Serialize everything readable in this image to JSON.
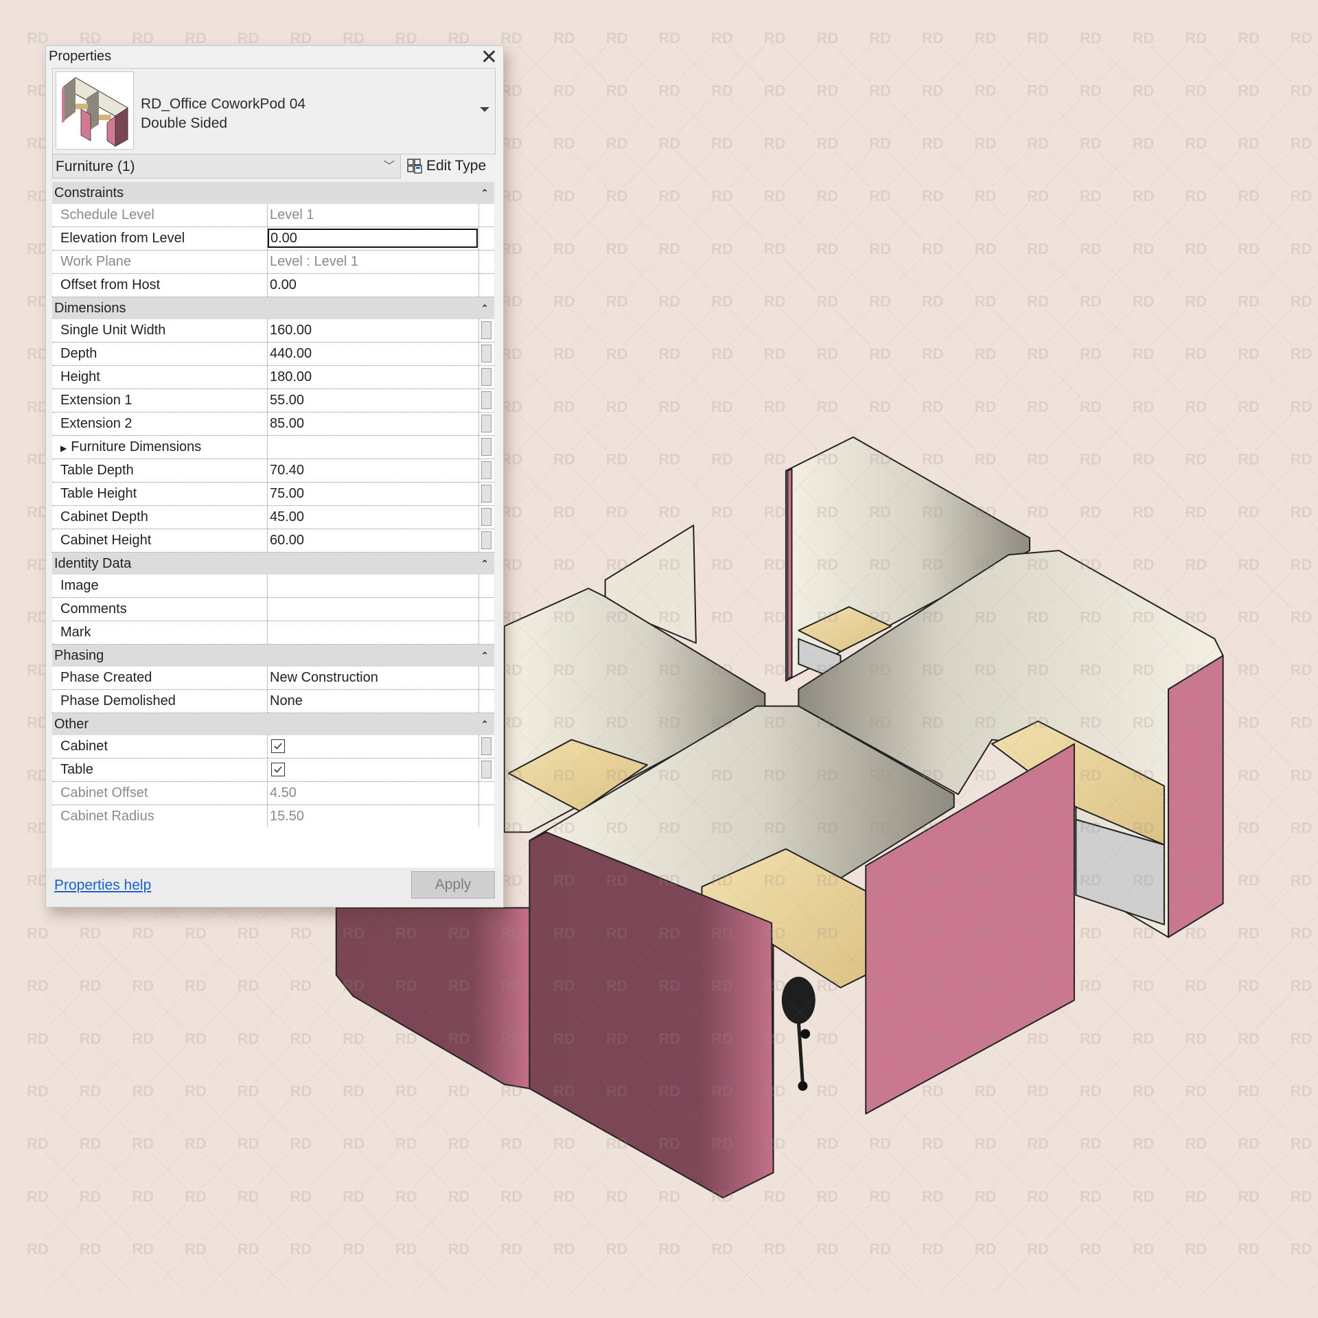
{
  "watermark": {
    "text": "RD"
  },
  "colors": {
    "background": "#efe2db",
    "pod_pink": "#c97890",
    "pod_pink_shadow": "#7c4656",
    "pod_inner": "#ebe7d9",
    "pod_inner_shadow": "#9a968a",
    "table_wood": "#ecd7a0",
    "cabinet_grey": "#cfcfcf",
    "link_blue": "#1a62c9"
  },
  "properties_panel": {
    "title": "Properties",
    "close_icon": "close-icon",
    "type_selector": {
      "family": "RD_Office CoworkPod 04",
      "type": "Double Sided"
    },
    "instance_filter": "Furniture (1)",
    "edit_type_label": "Edit Type",
    "groups": [
      {
        "name": "Constraints",
        "rows": [
          {
            "label": "Schedule Level",
            "value": "Level 1",
            "readonly": true
          },
          {
            "label": "Elevation from Level",
            "value": "0.00",
            "editing": true
          },
          {
            "label": "Work Plane",
            "value": "Level : Level 1",
            "readonly": true
          },
          {
            "label": "Offset from Host",
            "value": "0.00"
          }
        ]
      },
      {
        "name": "Dimensions",
        "rows": [
          {
            "label": "Single Unit Width",
            "value": "160.00",
            "assoc": true
          },
          {
            "label": "Depth",
            "value": "440.00",
            "assoc": true
          },
          {
            "label": "Height",
            "value": "180.00",
            "assoc": true
          },
          {
            "label": "Extension 1",
            "value": "55.00",
            "assoc": true
          },
          {
            "label": "Extension 2",
            "value": "85.00",
            "assoc": true
          },
          {
            "label": "Furniture Dimensions",
            "value": "",
            "assoc": true,
            "expandable": true
          },
          {
            "label": "Table Depth",
            "value": "70.40",
            "assoc": true
          },
          {
            "label": "Table Height",
            "value": "75.00",
            "assoc": true
          },
          {
            "label": "Cabinet Depth",
            "value": "45.00",
            "assoc": true
          },
          {
            "label": "Cabinet Height",
            "value": "60.00",
            "assoc": true
          }
        ]
      },
      {
        "name": "Identity Data",
        "rows": [
          {
            "label": "Image",
            "value": ""
          },
          {
            "label": "Comments",
            "value": ""
          },
          {
            "label": "Mark",
            "value": ""
          }
        ]
      },
      {
        "name": "Phasing",
        "rows": [
          {
            "label": "Phase Created",
            "value": "New Construction"
          },
          {
            "label": "Phase Demolished",
            "value": "None"
          }
        ]
      },
      {
        "name": "Other",
        "rows": [
          {
            "label": "Cabinet",
            "checkbox": true,
            "checked": true,
            "assoc": true
          },
          {
            "label": "Table",
            "checkbox": true,
            "checked": true,
            "assoc": true
          },
          {
            "label": "Cabinet Offset",
            "value": "4.50",
            "readonly": true
          },
          {
            "label": "Cabinet Radius",
            "value": "15.50",
            "readonly": true
          }
        ]
      }
    ],
    "help_link": "Properties help",
    "apply_label": "Apply"
  }
}
